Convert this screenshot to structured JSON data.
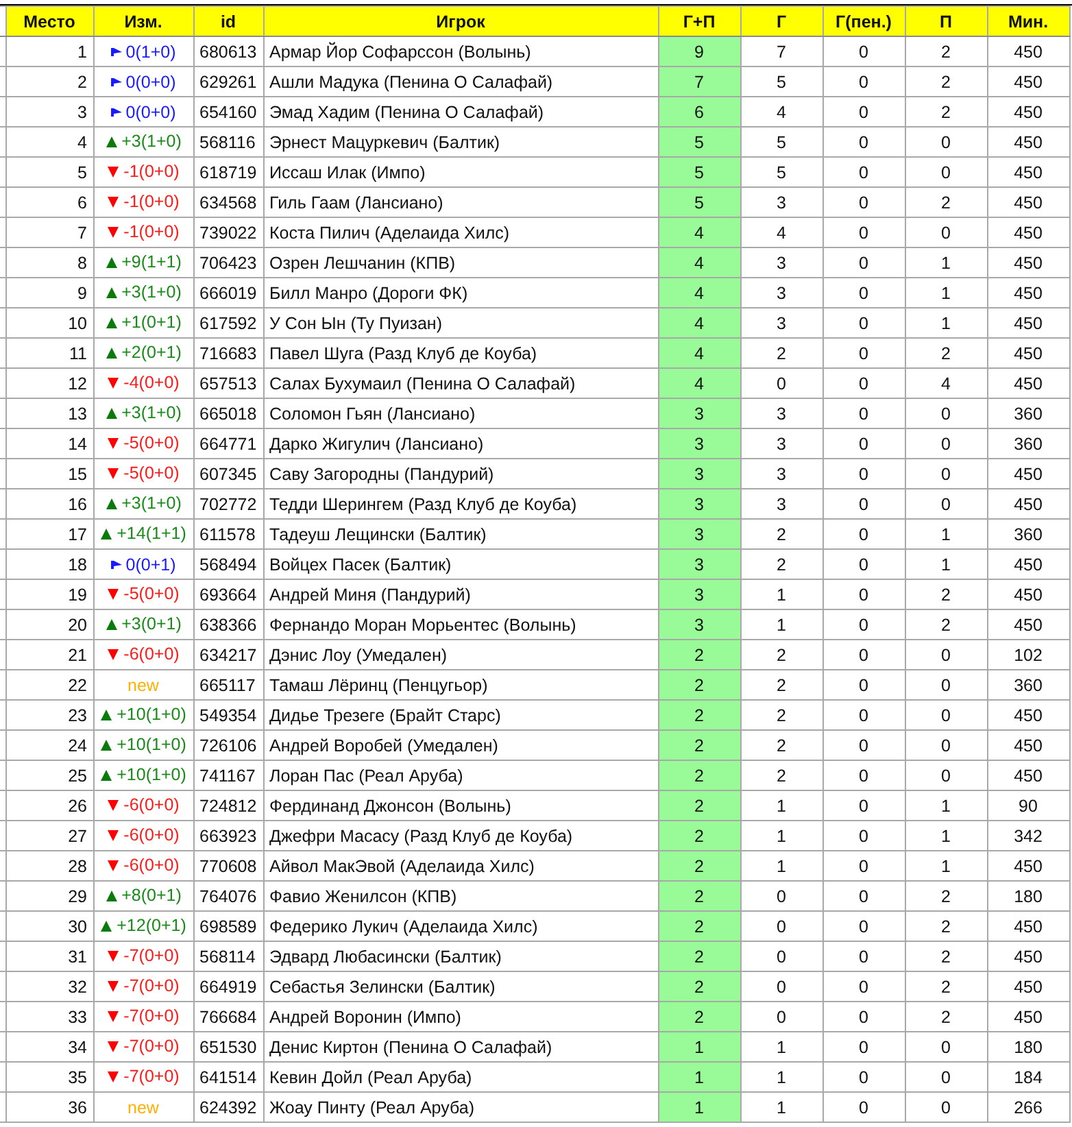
{
  "table": {
    "columns": [
      "Место",
      "Изм.",
      "id",
      "Игрок",
      "Г+П",
      "Г",
      "Г(пен.)",
      "П",
      "Мин."
    ],
    "rows": [
      {
        "place": "1",
        "change": {
          "kind": "same",
          "text": "0(1+0)"
        },
        "id": "680613",
        "player": "Армар Йор Софарссон (Волынь)",
        "gp": "9",
        "g": "7",
        "gpen": "0",
        "p": "2",
        "min": "450"
      },
      {
        "place": "2",
        "change": {
          "kind": "same",
          "text": "0(0+0)"
        },
        "id": "629261",
        "player": "Ашли Мадука (Пенина О Салафай)",
        "gp": "7",
        "g": "5",
        "gpen": "0",
        "p": "2",
        "min": "450"
      },
      {
        "place": "3",
        "change": {
          "kind": "same",
          "text": "0(0+0)"
        },
        "id": "654160",
        "player": "Эмад Хадим (Пенина О Салафай)",
        "gp": "6",
        "g": "4",
        "gpen": "0",
        "p": "2",
        "min": "450"
      },
      {
        "place": "4",
        "change": {
          "kind": "up",
          "text": "+3(1+0)"
        },
        "id": "568116",
        "player": "Эрнест Мацуркевич (Балтик)",
        "gp": "5",
        "g": "5",
        "gpen": "0",
        "p": "0",
        "min": "450"
      },
      {
        "place": "5",
        "change": {
          "kind": "down",
          "text": "-1(0+0)"
        },
        "id": "618719",
        "player": "Иссаш Илак (Импо)",
        "gp": "5",
        "g": "5",
        "gpen": "0",
        "p": "0",
        "min": "450"
      },
      {
        "place": "6",
        "change": {
          "kind": "down",
          "text": "-1(0+0)"
        },
        "id": "634568",
        "player": "Гиль Гаам (Лансиано)",
        "gp": "5",
        "g": "3",
        "gpen": "0",
        "p": "2",
        "min": "450"
      },
      {
        "place": "7",
        "change": {
          "kind": "down",
          "text": "-1(0+0)"
        },
        "id": "739022",
        "player": "Коста Пилич (Аделаида Хилс)",
        "gp": "4",
        "g": "4",
        "gpen": "0",
        "p": "0",
        "min": "450"
      },
      {
        "place": "8",
        "change": {
          "kind": "up",
          "text": "+9(1+1)"
        },
        "id": "706423",
        "player": "Озрен Лешчанин (КПВ)",
        "gp": "4",
        "g": "3",
        "gpen": "0",
        "p": "1",
        "min": "450"
      },
      {
        "place": "9",
        "change": {
          "kind": "up",
          "text": "+3(1+0)"
        },
        "id": "666019",
        "player": "Билл Манро (Дороги ФК)",
        "gp": "4",
        "g": "3",
        "gpen": "0",
        "p": "1",
        "min": "450"
      },
      {
        "place": "10",
        "change": {
          "kind": "up",
          "text": "+1(0+1)"
        },
        "id": "617592",
        "player": "У Сон Ын (Ту Пуизан)",
        "gp": "4",
        "g": "3",
        "gpen": "0",
        "p": "1",
        "min": "450"
      },
      {
        "place": "11",
        "change": {
          "kind": "up",
          "text": "+2(0+1)"
        },
        "id": "716683",
        "player": "Павел Шуга (Разд Клуб де Коуба)",
        "gp": "4",
        "g": "2",
        "gpen": "0",
        "p": "2",
        "min": "450"
      },
      {
        "place": "12",
        "change": {
          "kind": "down",
          "text": "-4(0+0)"
        },
        "id": "657513",
        "player": "Салах Бухумаил (Пенина О Салафай)",
        "gp": "4",
        "g": "0",
        "gpen": "0",
        "p": "4",
        "min": "450"
      },
      {
        "place": "13",
        "change": {
          "kind": "up",
          "text": "+3(1+0)"
        },
        "id": "665018",
        "player": "Соломон Гьян (Лансиано)",
        "gp": "3",
        "g": "3",
        "gpen": "0",
        "p": "0",
        "min": "360"
      },
      {
        "place": "14",
        "change": {
          "kind": "down",
          "text": "-5(0+0)"
        },
        "id": "664771",
        "player": "Дарко Жигулич (Лансиано)",
        "gp": "3",
        "g": "3",
        "gpen": "0",
        "p": "0",
        "min": "360"
      },
      {
        "place": "15",
        "change": {
          "kind": "down",
          "text": "-5(0+0)"
        },
        "id": "607345",
        "player": "Саву Загородны (Пандурий)",
        "gp": "3",
        "g": "3",
        "gpen": "0",
        "p": "0",
        "min": "450"
      },
      {
        "place": "16",
        "change": {
          "kind": "up",
          "text": "+3(1+0)"
        },
        "id": "702772",
        "player": "Тедди Шерингем (Разд Клуб де Коуба)",
        "gp": "3",
        "g": "3",
        "gpen": "0",
        "p": "0",
        "min": "450"
      },
      {
        "place": "17",
        "change": {
          "kind": "up",
          "text": "+14(1+1)"
        },
        "id": "611578",
        "player": "Тадеуш Лещински (Балтик)",
        "gp": "3",
        "g": "2",
        "gpen": "0",
        "p": "1",
        "min": "360"
      },
      {
        "place": "18",
        "change": {
          "kind": "same",
          "text": "0(0+1)"
        },
        "id": "568494",
        "player": "Войцех Пасек (Балтик)",
        "gp": "3",
        "g": "2",
        "gpen": "0",
        "p": "1",
        "min": "450"
      },
      {
        "place": "19",
        "change": {
          "kind": "down",
          "text": "-5(0+0)"
        },
        "id": "693664",
        "player": "Андрей Миня (Пандурий)",
        "gp": "3",
        "g": "1",
        "gpen": "0",
        "p": "2",
        "min": "450"
      },
      {
        "place": "20",
        "change": {
          "kind": "up",
          "text": "+3(0+1)"
        },
        "id": "638366",
        "player": "Фернандо Моран Морьентес (Волынь)",
        "gp": "3",
        "g": "1",
        "gpen": "0",
        "p": "2",
        "min": "450"
      },
      {
        "place": "21",
        "change": {
          "kind": "down",
          "text": "-6(0+0)"
        },
        "id": "634217",
        "player": "Дэнис Лоу (Умедален)",
        "gp": "2",
        "g": "2",
        "gpen": "0",
        "p": "0",
        "min": "102"
      },
      {
        "place": "22",
        "change": {
          "kind": "new",
          "text": "new"
        },
        "id": "665117",
        "player": "Тамаш Лёринц (Пенцугьор)",
        "gp": "2",
        "g": "2",
        "gpen": "0",
        "p": "0",
        "min": "360"
      },
      {
        "place": "23",
        "change": {
          "kind": "up",
          "text": "+10(1+0)"
        },
        "id": "549354",
        "player": "Дидье Трезеге (Брайт Старс)",
        "gp": "2",
        "g": "2",
        "gpen": "0",
        "p": "0",
        "min": "450"
      },
      {
        "place": "24",
        "change": {
          "kind": "up",
          "text": "+10(1+0)"
        },
        "id": "726106",
        "player": "Андрей Воробей (Умедален)",
        "gp": "2",
        "g": "2",
        "gpen": "0",
        "p": "0",
        "min": "450"
      },
      {
        "place": "25",
        "change": {
          "kind": "up",
          "text": "+10(1+0)"
        },
        "id": "741167",
        "player": "Лоран Пас (Реал Аруба)",
        "gp": "2",
        "g": "2",
        "gpen": "0",
        "p": "0",
        "min": "450"
      },
      {
        "place": "26",
        "change": {
          "kind": "down",
          "text": "-6(0+0)"
        },
        "id": "724812",
        "player": "Фердинанд Джонсон (Волынь)",
        "gp": "2",
        "g": "1",
        "gpen": "0",
        "p": "1",
        "min": "90"
      },
      {
        "place": "27",
        "change": {
          "kind": "down",
          "text": "-6(0+0)"
        },
        "id": "663923",
        "player": "Джефри Масасу (Разд Клуб де Коуба)",
        "gp": "2",
        "g": "1",
        "gpen": "0",
        "p": "1",
        "min": "342"
      },
      {
        "place": "28",
        "change": {
          "kind": "down",
          "text": "-6(0+0)"
        },
        "id": "770608",
        "player": "Айвол МакЭвой (Аделаида Хилс)",
        "gp": "2",
        "g": "1",
        "gpen": "0",
        "p": "1",
        "min": "450"
      },
      {
        "place": "29",
        "change": {
          "kind": "up",
          "text": "+8(0+1)"
        },
        "id": "764076",
        "player": "Фавио Женилсон (КПВ)",
        "gp": "2",
        "g": "0",
        "gpen": "0",
        "p": "2",
        "min": "180"
      },
      {
        "place": "30",
        "change": {
          "kind": "up",
          "text": "+12(0+1)"
        },
        "id": "698589",
        "player": "Федерико Лукич (Аделаида Хилс)",
        "gp": "2",
        "g": "0",
        "gpen": "0",
        "p": "2",
        "min": "450"
      },
      {
        "place": "31",
        "change": {
          "kind": "down",
          "text": "-7(0+0)"
        },
        "id": "568114",
        "player": "Эдвард Любасински (Балтик)",
        "gp": "2",
        "g": "0",
        "gpen": "0",
        "p": "2",
        "min": "450"
      },
      {
        "place": "32",
        "change": {
          "kind": "down",
          "text": "-7(0+0)"
        },
        "id": "664919",
        "player": "Себастья Зелински (Балтик)",
        "gp": "2",
        "g": "0",
        "gpen": "0",
        "p": "2",
        "min": "450"
      },
      {
        "place": "33",
        "change": {
          "kind": "down",
          "text": "-7(0+0)"
        },
        "id": "766684",
        "player": "Андрей Воронин (Импо)",
        "gp": "2",
        "g": "0",
        "gpen": "0",
        "p": "2",
        "min": "450"
      },
      {
        "place": "34",
        "change": {
          "kind": "down",
          "text": "-7(0+0)"
        },
        "id": "651530",
        "player": "Денис Киртон (Пенина О Салафай)",
        "gp": "1",
        "g": "1",
        "gpen": "0",
        "p": "0",
        "min": "180"
      },
      {
        "place": "35",
        "change": {
          "kind": "down",
          "text": "-7(0+0)"
        },
        "id": "641514",
        "player": "Кевин Дойл (Реал Аруба)",
        "gp": "1",
        "g": "1",
        "gpen": "0",
        "p": "0",
        "min": "184"
      },
      {
        "place": "36",
        "change": {
          "kind": "new",
          "text": "new"
        },
        "id": "624392",
        "player": "Жоау Пинту (Реал Аруба)",
        "gp": "1",
        "g": "1",
        "gpen": "0",
        "p": "0",
        "min": "266"
      }
    ]
  }
}
